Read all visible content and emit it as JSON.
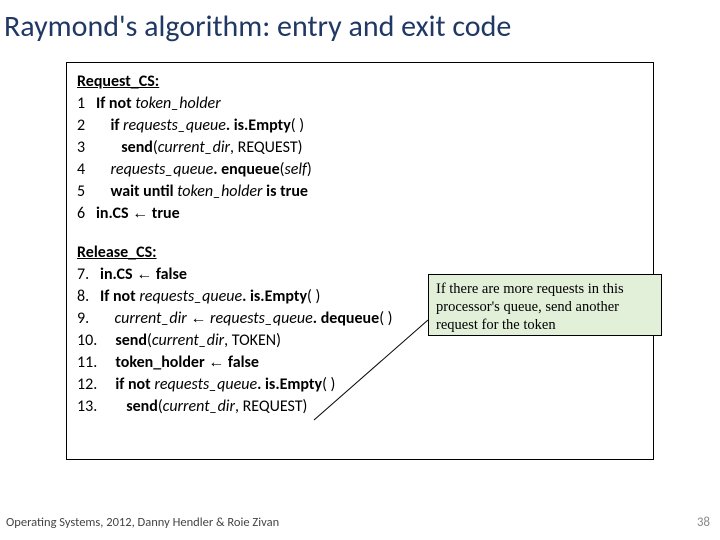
{
  "title": "Raymond's algorithm: entry and exit code",
  "request": {
    "heading": "Request_CS:",
    "lines": [
      {
        "n": "1",
        "pre": "   ",
        "parts": [
          {
            "t": "If not ",
            "c": "b"
          },
          {
            "t": "token_holder",
            "c": "i"
          }
        ]
      },
      {
        "n": "2",
        "pre": "       ",
        "parts": [
          {
            "t": "if ",
            "c": "b"
          },
          {
            "t": "requests_queue",
            "c": "i"
          },
          {
            "t": ". is.Empty",
            "c": "b"
          },
          {
            "t": "( )"
          }
        ]
      },
      {
        "n": "3",
        "pre": "          ",
        "parts": [
          {
            "t": "send",
            "c": "b"
          },
          {
            "t": "("
          },
          {
            "t": "current_dir",
            "c": "i"
          },
          {
            "t": ", REQUEST)"
          }
        ]
      },
      {
        "n": "4",
        "pre": "       ",
        "parts": [
          {
            "t": "requests_queue",
            "c": "i"
          },
          {
            "t": ". enqueue",
            "c": "b"
          },
          {
            "t": "("
          },
          {
            "t": "self",
            "c": "i"
          },
          {
            "t": ")"
          }
        ]
      },
      {
        "n": "5",
        "pre": "       ",
        "parts": [
          {
            "t": "wait until ",
            "c": "b"
          },
          {
            "t": "token_holder",
            "c": "i"
          },
          {
            "t": " is true",
            "c": "b"
          }
        ]
      },
      {
        "n": "6",
        "pre": "   ",
        "parts": [
          {
            "t": "in.CS",
            "c": "b"
          },
          {
            "t": " "
          },
          {
            "t": "←",
            "c": "arrow"
          },
          {
            "t": " "
          },
          {
            "t": "true",
            "c": "b"
          }
        ]
      }
    ]
  },
  "release": {
    "heading": "Release_CS:",
    "lines": [
      {
        "n": "7.",
        "pre": "   ",
        "parts": [
          {
            "t": "in.CS",
            "c": "b"
          },
          {
            "t": " "
          },
          {
            "t": "←",
            "c": "arrow"
          },
          {
            "t": " "
          },
          {
            "t": "false",
            "c": "b"
          }
        ]
      },
      {
        "n": "8.",
        "pre": "   ",
        "parts": [
          {
            "t": "If not ",
            "c": "b"
          },
          {
            "t": "requests_queue",
            "c": "i"
          },
          {
            "t": ". is.Empty",
            "c": "b"
          },
          {
            "t": "( )"
          }
        ]
      },
      {
        "n": "9.",
        "pre": "       ",
        "parts": [
          {
            "t": "current_dir",
            "c": "i"
          },
          {
            "t": " "
          },
          {
            "t": "←",
            "c": "arrow"
          },
          {
            "t": " "
          },
          {
            "t": "requests_queue",
            "c": "i"
          },
          {
            "t": ". dequeue",
            "c": "b"
          },
          {
            "t": "( )"
          }
        ]
      },
      {
        "n": "10.",
        "pre": "     ",
        "parts": [
          {
            "t": "send",
            "c": "b"
          },
          {
            "t": "("
          },
          {
            "t": "current_dir",
            "c": "i"
          },
          {
            "t": ", TOKEN)"
          }
        ]
      },
      {
        "n": "11.",
        "pre": "     ",
        "parts": [
          {
            "t": "token_holder",
            "c": "b"
          },
          {
            "t": " "
          },
          {
            "t": "←",
            "c": "arrow"
          },
          {
            "t": " "
          },
          {
            "t": "false",
            "c": "b"
          }
        ]
      },
      {
        "n": "12.",
        "pre": "     ",
        "parts": [
          {
            "t": "if not ",
            "c": "b"
          },
          {
            "t": "requests_queue",
            "c": "i"
          },
          {
            "t": ". is.Empty",
            "c": "b"
          },
          {
            "t": "( )"
          }
        ]
      },
      {
        "n": "13.",
        "pre": "        ",
        "parts": [
          {
            "t": "send",
            "c": "b"
          },
          {
            "t": "("
          },
          {
            "t": "current_dir",
            "c": "i"
          },
          {
            "t": ", REQUEST)"
          }
        ]
      }
    ]
  },
  "callout": "If there are more requests in this processor's queue, send another request for the token",
  "footer": "Operating Systems, 2012, Danny Hendler & Roie Zivan",
  "page": "38"
}
